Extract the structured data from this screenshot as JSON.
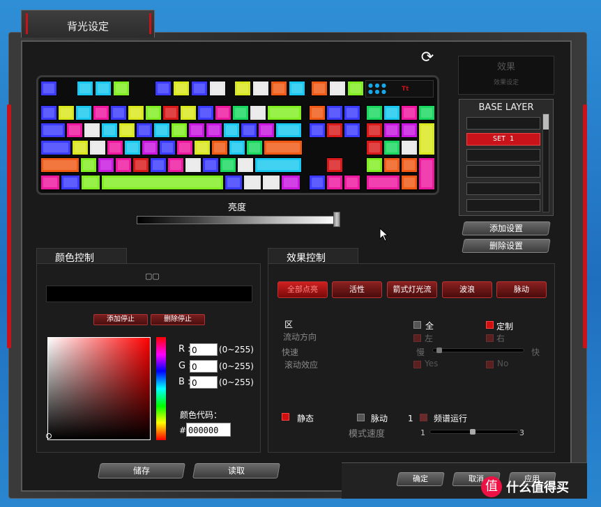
{
  "window": {
    "title": "背光设定"
  },
  "refresh_icon": "refresh-icon",
  "keyboard": {
    "logo_text": "Tt",
    "keys": [
      {
        "c": "#3b3bff"
      },
      {
        "c": "#18c8f0"
      },
      {
        "c": "#18c8f0"
      },
      {
        "c": "#80ee20"
      },
      {
        "c": "#3b3bff"
      },
      {
        "c": "#d9e81c"
      },
      {
        "c": "#3b3bff"
      },
      {
        "c": "#e8e8e8"
      },
      {
        "c": "#d9e81c"
      },
      {
        "c": "#e8e8e8"
      },
      {
        "c": "#f05a14"
      },
      {
        "c": "#18c8f0"
      },
      {
        "c": "#f05a14"
      },
      {
        "c": "#e8e8e8"
      },
      {
        "c": "#80ee20"
      },
      {
        "c": "#e8e8e8"
      },
      {
        "c": "#ee18a0"
      }
    ]
  },
  "brightness": {
    "label": "亮度",
    "value": 1.0
  },
  "effect_panel": {
    "title": "效果",
    "subtitle": "效果设定"
  },
  "layers": {
    "title": "BASE LAYER",
    "items": [
      "",
      "SET 1",
      "",
      "",
      "",
      ""
    ],
    "selected_index": 1
  },
  "buttons": {
    "add_setting": "添加设置",
    "delete_setting": "删除设置",
    "save": "储存",
    "load": "读取",
    "ok": "确定",
    "cancel": "取消",
    "apply": "应用"
  },
  "color_control": {
    "tab_label": "颜色控制",
    "add_stop": "添加停止",
    "delete_stop": "删除停止",
    "r_label": "R :",
    "g_label": "G :",
    "b_label": "B :",
    "r_value": "0",
    "g_value": "0",
    "b_value": "0",
    "range": "(0~255)",
    "hex_label": "颜色代码：",
    "hex_hash": "#",
    "hex_value": "000000"
  },
  "effect_control": {
    "tab_label": "效果控制",
    "effects": [
      "全部点亮",
      "活性",
      "箭式灯光流",
      "波浪",
      "脉动"
    ],
    "active_effect": 0,
    "zone_label": "区",
    "direction_label": "流动方向",
    "speed_label": "快速",
    "scroll_label": "滚动效应",
    "all": "全",
    "custom": "定制",
    "left": "左",
    "right": "右",
    "slow": "慢",
    "fast": "快",
    "yes": "Yes",
    "no": "No",
    "static": "静态",
    "pulse": "脉动",
    "spectrum_num": "1",
    "spectrum": "频谱运行",
    "mode_speed": "模式速度",
    "mode_min": "1",
    "mode_max": "3"
  },
  "watermark": {
    "icon": "值",
    "text": "什么值得买"
  }
}
